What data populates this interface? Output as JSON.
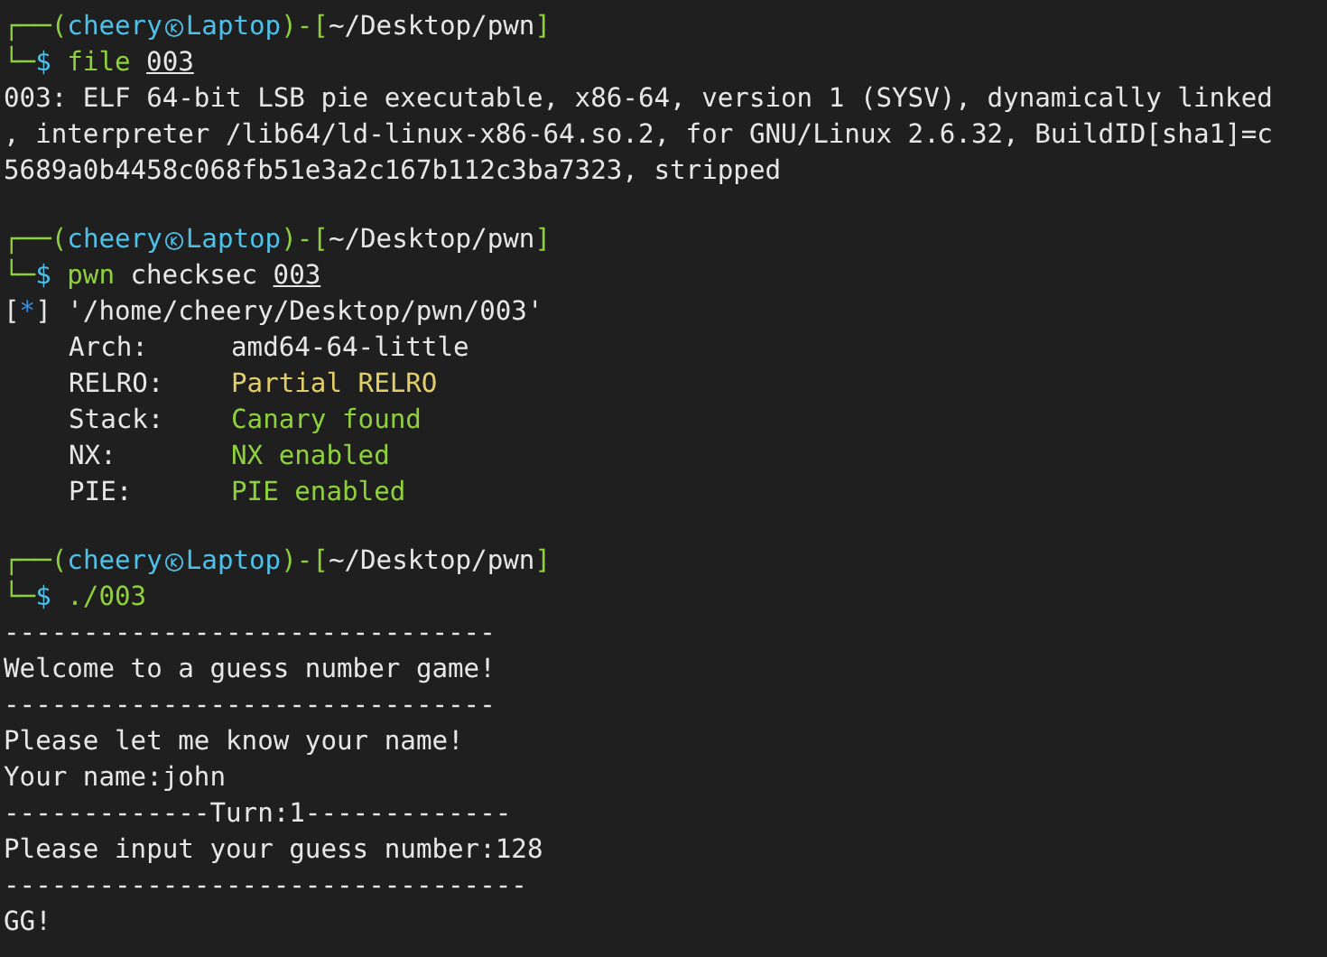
{
  "terminal": {
    "blocks": [
      {
        "prompt": {
          "open": "┌──(",
          "user": "cheery",
          "host": "Laptop",
          "mid": ")-[",
          "path": "~/Desktop/pwn",
          "close": "]",
          "corner": "└─",
          "symbol": "$"
        },
        "command": [
          {
            "text": "file",
            "kind": "program"
          },
          {
            "text": "003",
            "kind": "path"
          }
        ],
        "output": [
          {
            "kind": "text",
            "text": "003: ELF 64-bit LSB pie executable, x86-64, version 1 (SYSV), dynamically linked"
          },
          {
            "kind": "text",
            "text": ", interpreter /lib64/ld-linux-x86-64.so.2, for GNU/Linux 2.6.32, BuildID[sha1]=c"
          },
          {
            "kind": "text",
            "text": "5689a0b4458c068fb51e3a2c167b112c3ba7323, stripped"
          }
        ]
      },
      {
        "prompt": {
          "open": "┌──(",
          "user": "cheery",
          "host": "Laptop",
          "mid": ")-[",
          "path": "~/Desktop/pwn",
          "close": "]",
          "corner": "└─",
          "symbol": "$"
        },
        "command": [
          {
            "text": "pwn",
            "kind": "program"
          },
          {
            "text": "checksec",
            "kind": "word"
          },
          {
            "text": "003",
            "kind": "path"
          }
        ],
        "output": [
          {
            "kind": "info",
            "open": "[",
            "marker": "*",
            "close": "]",
            "text": "'/home/cheery/Desktop/pwn/003'"
          },
          {
            "kind": "field",
            "label": "Arch:",
            "value": "amd64-64-little",
            "color": "#e6e6e6"
          },
          {
            "kind": "field",
            "label": "RELRO:",
            "value": "Partial RELRO",
            "color": "#e2cf6a"
          },
          {
            "kind": "field",
            "label": "Stack:",
            "value": "Canary found",
            "color": "#8fd13c"
          },
          {
            "kind": "field",
            "label": "NX:",
            "value": "NX enabled",
            "color": "#8fd13c"
          },
          {
            "kind": "field",
            "label": "PIE:",
            "value": "PIE enabled",
            "color": "#8fd13c"
          }
        ]
      },
      {
        "prompt": {
          "open": "┌──(",
          "user": "cheery",
          "host": "Laptop",
          "mid": ")-[",
          "path": "~/Desktop/pwn",
          "close": "]",
          "corner": "└─",
          "symbol": "$"
        },
        "command": [
          {
            "text": "./003",
            "kind": "program"
          }
        ],
        "output": [
          {
            "kind": "text",
            "text": "-------------------------------"
          },
          {
            "kind": "text",
            "text": "Welcome to a guess number game!"
          },
          {
            "kind": "text",
            "text": "-------------------------------"
          },
          {
            "kind": "text",
            "text": "Please let me know your name!"
          },
          {
            "kind": "text",
            "text": "Your name:john"
          },
          {
            "kind": "text",
            "text": "-------------Turn:1-------------"
          },
          {
            "kind": "text",
            "text": "Please input your guess number:128"
          },
          {
            "kind": "text",
            "text": "---------------------------------"
          },
          {
            "kind": "text",
            "text": "GG!"
          }
        ]
      }
    ]
  }
}
